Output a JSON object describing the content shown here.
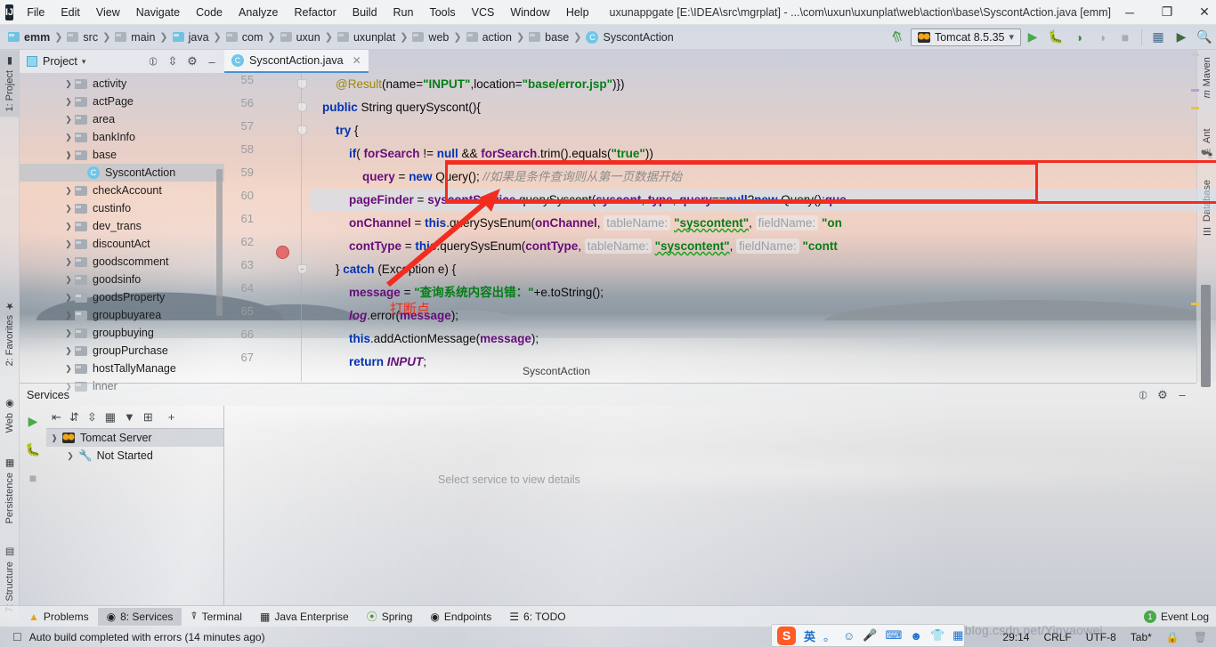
{
  "window": {
    "title": "uxunappgate [E:\\IDEA\\src\\mgrplat] - ...\\com\\uxun\\uxunplat\\web\\action\\base\\SyscontAction.java [emm]",
    "minimize": "─",
    "maximize": "❐",
    "close": "✕",
    "logo": "IJ"
  },
  "menu": [
    "File",
    "Edit",
    "View",
    "Navigate",
    "Code",
    "Analyze",
    "Refactor",
    "Build",
    "Run",
    "Tools",
    "VCS",
    "Window",
    "Help"
  ],
  "breadcrumb": [
    {
      "label": "emm",
      "type": "module"
    },
    {
      "label": "src",
      "type": "folder"
    },
    {
      "label": "main",
      "type": "folder"
    },
    {
      "label": "java",
      "type": "source"
    },
    {
      "label": "com",
      "type": "folder"
    },
    {
      "label": "uxun",
      "type": "folder"
    },
    {
      "label": "uxunplat",
      "type": "folder"
    },
    {
      "label": "web",
      "type": "folder"
    },
    {
      "label": "action",
      "type": "folder"
    },
    {
      "label": "base",
      "type": "folder"
    },
    {
      "label": "SyscontAction",
      "type": "class"
    }
  ],
  "run_config": {
    "name": "Tomcat 8.5.35",
    "dropdown_caret": "⌄",
    "buttons": [
      "run-button",
      "debug-button",
      "run-with-coverage-button",
      "profile-button",
      "stop-button",
      "project-structure-button",
      "update-application-button",
      "search-everywhere-button"
    ]
  },
  "left_tool_strip": [
    {
      "label": "1: Project",
      "active": true
    },
    {
      "label": "2: Favorites",
      "active": false
    },
    {
      "label": "Web",
      "active": false
    },
    {
      "label": "Persistence",
      "active": false
    },
    {
      "label": "7: Structure",
      "active": false
    }
  ],
  "right_tool_strip": [
    {
      "label": "Maven"
    },
    {
      "label": "Ant"
    },
    {
      "label": "Database"
    }
  ],
  "project_panel": {
    "title": "Project",
    "tools": [
      "locate-icon",
      "collapse-all-icon",
      "settings-icon",
      "hide-icon"
    ],
    "tree": [
      {
        "label": "activity",
        "type": "folder",
        "expanded": false,
        "indent": 1
      },
      {
        "label": "actPage",
        "type": "folder",
        "expanded": false,
        "indent": 1
      },
      {
        "label": "area",
        "type": "folder",
        "expanded": false,
        "indent": 1
      },
      {
        "label": "bankInfo",
        "type": "folder",
        "expanded": false,
        "indent": 1
      },
      {
        "label": "base",
        "type": "folder",
        "expanded": true,
        "indent": 1
      },
      {
        "label": "SyscontAction",
        "type": "class",
        "selected": true,
        "indent": 2
      },
      {
        "label": "checkAccount",
        "type": "folder",
        "expanded": false,
        "indent": 1
      },
      {
        "label": "custinfo",
        "type": "folder",
        "expanded": false,
        "indent": 1
      },
      {
        "label": "dev_trans",
        "type": "folder",
        "expanded": false,
        "indent": 1
      },
      {
        "label": "discountAct",
        "type": "folder",
        "expanded": false,
        "indent": 1
      },
      {
        "label": "goodscomment",
        "type": "folder",
        "expanded": false,
        "indent": 1
      },
      {
        "label": "goodsinfo",
        "type": "folder",
        "expanded": false,
        "indent": 1
      },
      {
        "label": "goodsProperty",
        "type": "folder",
        "expanded": false,
        "indent": 1
      },
      {
        "label": "groupbuyarea",
        "type": "folder",
        "expanded": false,
        "indent": 1
      },
      {
        "label": "groupbuying",
        "type": "folder",
        "expanded": false,
        "indent": 1
      },
      {
        "label": "groupPurchase",
        "type": "folder",
        "expanded": false,
        "indent": 1
      },
      {
        "label": "hostTallyManage",
        "type": "folder",
        "expanded": false,
        "indent": 1
      },
      {
        "label": "inner",
        "type": "folder",
        "expanded": false,
        "indent": 1
      }
    ]
  },
  "editor": {
    "tab": {
      "label": "SyscontAction.java",
      "close": "✕"
    },
    "breadcrumb_bottom": "SyscontAction",
    "line_numbers": [
      "55",
      "56",
      "57",
      "58",
      "59",
      "60",
      "61",
      "62",
      "63",
      "64",
      "65",
      "66",
      "67"
    ],
    "breakpoint_line": "60",
    "lines": [
      {
        "n": "55",
        "text": "        @Result(name=\"INPUT\",location=\"base/error.jsp\")})"
      },
      {
        "n": "56",
        "text": "    public String querySyscont(){"
      },
      {
        "n": "57",
        "text": "        try {"
      },
      {
        "n": "58",
        "text": "            if( forSearch != null && forSearch.trim().equals(\"true\"))"
      },
      {
        "n": "59",
        "text": "                query = new Query(); //如果是条件查询则从第一页数据开始"
      },
      {
        "n": "60",
        "text": "            pageFinder = syscontService.querySyscont(syscont, type, query==null?new Query():que"
      },
      {
        "n": "61",
        "text": "            onChannel = this.querySysEnum(onChannel,  tableName: \"syscontent\",  fieldName: \"on"
      },
      {
        "n": "62",
        "text": "            contType = this.querySysEnum(contType,  tableName: \"syscontent\",  fieldName: \"contt"
      },
      {
        "n": "63",
        "text": "        } catch (Exception e) {"
      },
      {
        "n": "64",
        "text": "            message = \"查询系统内容出错：\"+e.toString();"
      },
      {
        "n": "65",
        "text": "            log.error(message);"
      },
      {
        "n": "66",
        "text": "            this.addActionMessage(message);"
      },
      {
        "n": "67",
        "text": "            return INPUT;"
      }
    ]
  },
  "annotation": {
    "text": "打断点",
    "color": "#f22c1f"
  },
  "services": {
    "title": "Services",
    "header_tools": [
      "locate-icon",
      "settings-icon",
      "hide-icon"
    ],
    "run_strip": [
      "run-icon",
      "debug-icon",
      "stop-icon"
    ],
    "toolbar": [
      "rerun-icon",
      "expand-all-icon",
      "collapse-all-icon",
      "group-icon",
      "filter-icon",
      "add-tab-icon",
      "add-icon"
    ],
    "tree": [
      {
        "label": "Tomcat Server",
        "expanded": true,
        "indent": 0,
        "selected": true,
        "icon": "tomcat-icon"
      },
      {
        "label": "Not Started",
        "expanded": false,
        "indent": 1,
        "selected": false,
        "icon": "wrench-icon"
      }
    ],
    "empty_message": "Select service to view details"
  },
  "bottom_bar": {
    "tabs": [
      {
        "label": "Problems",
        "icon": "warning-icon",
        "active": false
      },
      {
        "label": "8: Services",
        "icon": "services-icon",
        "active": true
      },
      {
        "label": "Terminal",
        "icon": "terminal-icon",
        "active": false
      },
      {
        "label": "Java Enterprise",
        "icon": "java-enterprise-icon",
        "active": false
      },
      {
        "label": "Spring",
        "icon": "spring-icon",
        "active": false
      },
      {
        "label": "Endpoints",
        "icon": "endpoints-icon",
        "active": false
      },
      {
        "label": "6: TODO",
        "icon": "todo-icon",
        "active": false
      }
    ],
    "event_log": {
      "label": "Event Log",
      "count": "1"
    }
  },
  "status_bar": {
    "message": "Auto build completed with errors (14 minutes ago)",
    "caret_position": "29:14",
    "line_separator": "CRLF",
    "encoding": "UTF-8",
    "indent": "Tab*",
    "lock_icon": "lock-icon",
    "trash_icon": "trash-icon"
  },
  "watermark": "https://blog.csdn.net/Yinyaowei",
  "ime": {
    "brand": "S",
    "mode": "英",
    "items": [
      "punctuation-icon",
      "emoji-icon",
      "microphone-icon",
      "keyboard-icon",
      "user-icon",
      "skin-icon",
      "apps-icon"
    ]
  }
}
